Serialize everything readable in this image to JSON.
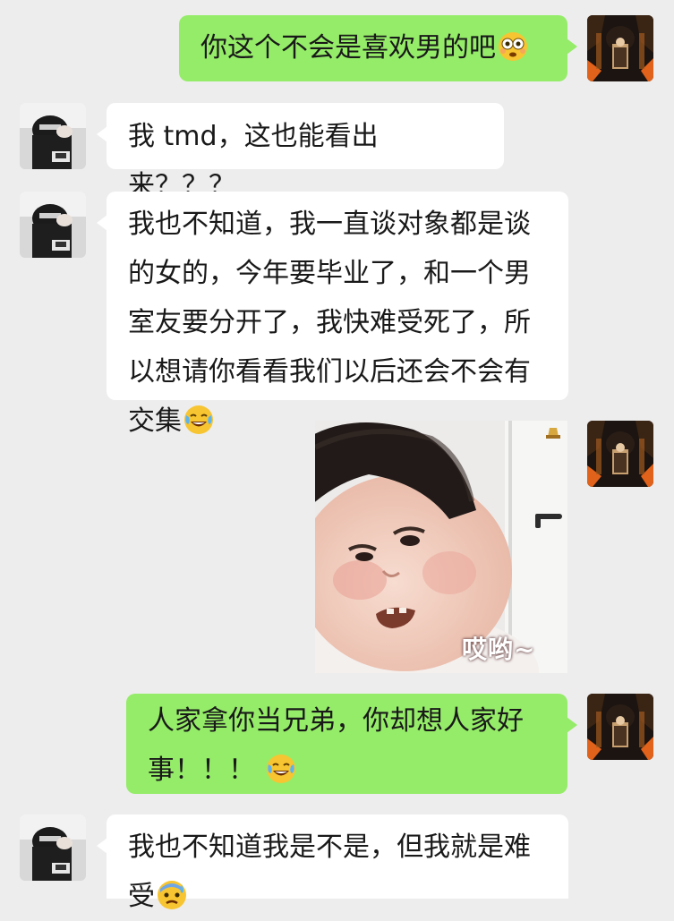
{
  "messages": [
    {
      "side": "me",
      "text": "你这个不会是喜欢男的吧",
      "emoji": "flushed-face-emoji"
    },
    {
      "side": "other",
      "text": "我 tmd，这也能看出来？？？"
    },
    {
      "side": "other",
      "lines": [
        "我也不知道，我一直谈对象都是谈",
        "的女的，今年要毕业了，和一个男",
        "室友要分开了，我快难受死了，所",
        "以想请你看看我们以后还会不会有",
        "交集"
      ],
      "emoji": "tears-of-joy-emoji"
    },
    {
      "side": "me",
      "type": "sticker",
      "sticker_text": "哎哟~"
    },
    {
      "side": "me",
      "lines": [
        "人家拿你当兄弟，你却想人家好",
        "事！！！"
      ],
      "emoji": "tears-of-joy-emoji"
    },
    {
      "side": "other",
      "lines": [
        "我也不知道我是不是，但我就是难",
        "受"
      ],
      "emoji": "anxious-sweat-emoji"
    }
  ],
  "colors": {
    "background": "#ededed",
    "my_bubble": "#95ec69",
    "other_bubble": "#ffffff"
  }
}
